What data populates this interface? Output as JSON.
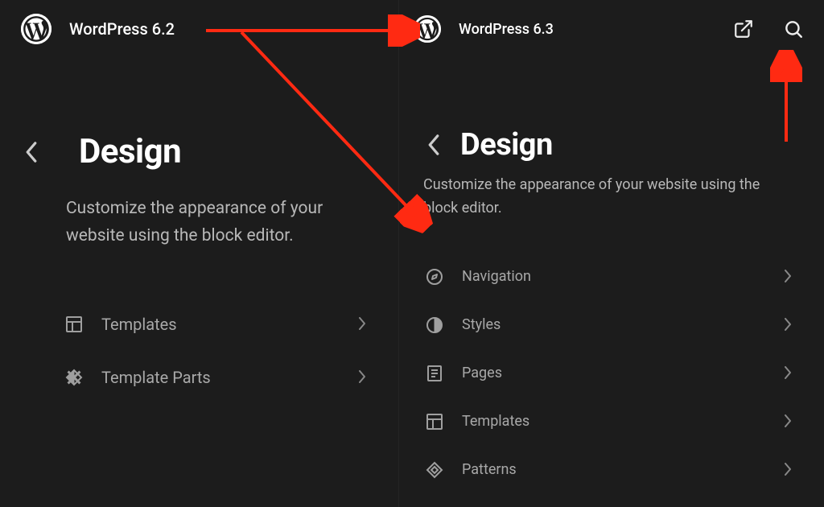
{
  "left": {
    "version_label": "WordPress 6.2",
    "page_title": "Design",
    "subtitle": "Customize the appearance of your website using the block editor.",
    "menu": [
      {
        "label": "Templates",
        "icon": "templates"
      },
      {
        "label": "Template Parts",
        "icon": "template-parts"
      }
    ]
  },
  "right": {
    "version_label": "WordPress 6.3",
    "page_title": "Design",
    "subtitle": "Customize the appearance of your website using the block editor.",
    "menu": [
      {
        "label": "Navigation",
        "icon": "navigation"
      },
      {
        "label": "Styles",
        "icon": "styles"
      },
      {
        "label": "Pages",
        "icon": "pages"
      },
      {
        "label": "Templates",
        "icon": "templates"
      },
      {
        "label": "Patterns",
        "icon": "patterns"
      }
    ]
  },
  "accent": "#ff2a12"
}
